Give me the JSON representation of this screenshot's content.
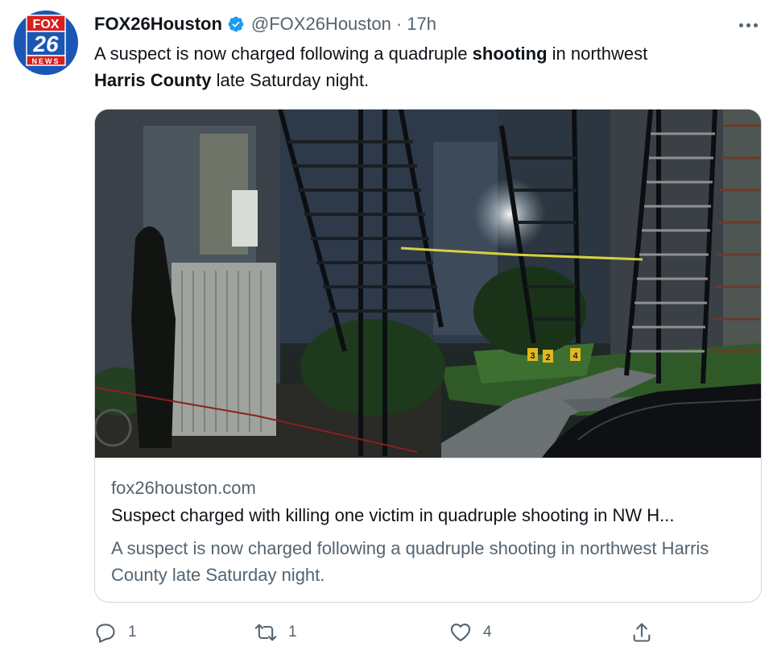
{
  "author": {
    "display_name": "FOX26Houston",
    "handle": "@FOX26Houston",
    "separator": "·",
    "time": "17h",
    "verified": true,
    "avatar": {
      "logo_top": "FOX",
      "logo_number": "26",
      "logo_bottom": "NEWS"
    }
  },
  "tweet": {
    "text_1": "A suspect is now charged following a quadruple ",
    "bold_1": "shooting",
    "text_2": " in northwest",
    "bold_2": "Harris County",
    "text_3": " late Saturday night."
  },
  "card": {
    "domain": "fox26houston.com",
    "title": "Suspect charged with killing one victim in quadruple shooting in NW H...",
    "description": "A suspect is now charged following a quadruple shooting in northwest Harris County late Saturday night.",
    "evidence_markers": [
      "3",
      "2",
      "4"
    ]
  },
  "actions": {
    "reply_count": "1",
    "retweet_count": "1",
    "like_count": "4"
  },
  "colors": {
    "text_primary": "#0f1419",
    "text_secondary": "#536471",
    "verified_blue": "#1d9bf0",
    "border": "#cfd9de",
    "avatar_blue": "#1a57b5",
    "fox_red": "#d6201f"
  }
}
